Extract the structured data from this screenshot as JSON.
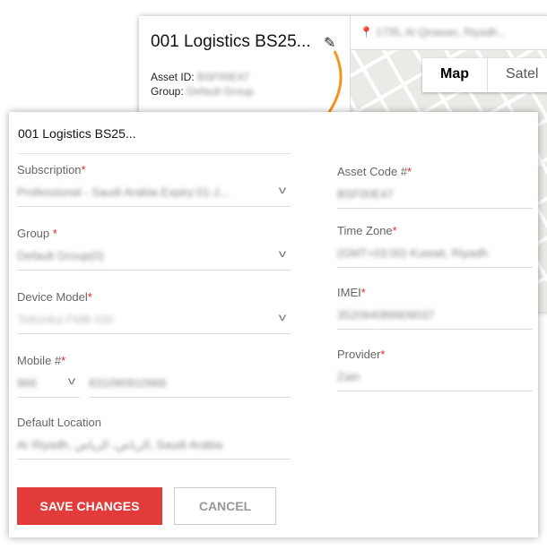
{
  "background_card": {
    "title": "001 Logistics BS25...",
    "asset_id_label": "Asset ID:",
    "asset_id": "BSF00E47",
    "group_label": "Group:",
    "group": "Default Group",
    "address": "1735, Al Qirawan, Riyadh...",
    "map_types": [
      "Map",
      "Satel"
    ]
  },
  "dialog": {
    "title": "001 Logistics BS25...",
    "fields": [
      {
        "label": "Subscription",
        "value": "Professional - Saudi Arabia Expiry:01-J..."
      },
      {
        "label": "Group ",
        "value": "Default Group(0)"
      },
      {
        "label": "Device Model",
        "value": "Teltonika FMB 030"
      },
      {
        "label": "Mobile #",
        "country_code": "966",
        "value": "831090910966"
      },
      {
        "label": "Default Location",
        "value": "Ar Riyadh, الرياض، الرياض, Saudi Arabia"
      },
      {
        "label": "Asset Code #",
        "value": "BSF00E47"
      },
      {
        "label": "Time Zone",
        "value": "(GMT+03:00) Kuwait, Riyadh"
      },
      {
        "label": "IMEI",
        "value": "352094089909037"
      },
      {
        "label": "Provider",
        "value": "Zain"
      }
    ],
    "required_marker": "*",
    "save_label": "SAVE CHANGES",
    "cancel_label": "CANCEL"
  },
  "colors": {
    "accent": "#e23b3a",
    "arrow": "#f7941d"
  }
}
